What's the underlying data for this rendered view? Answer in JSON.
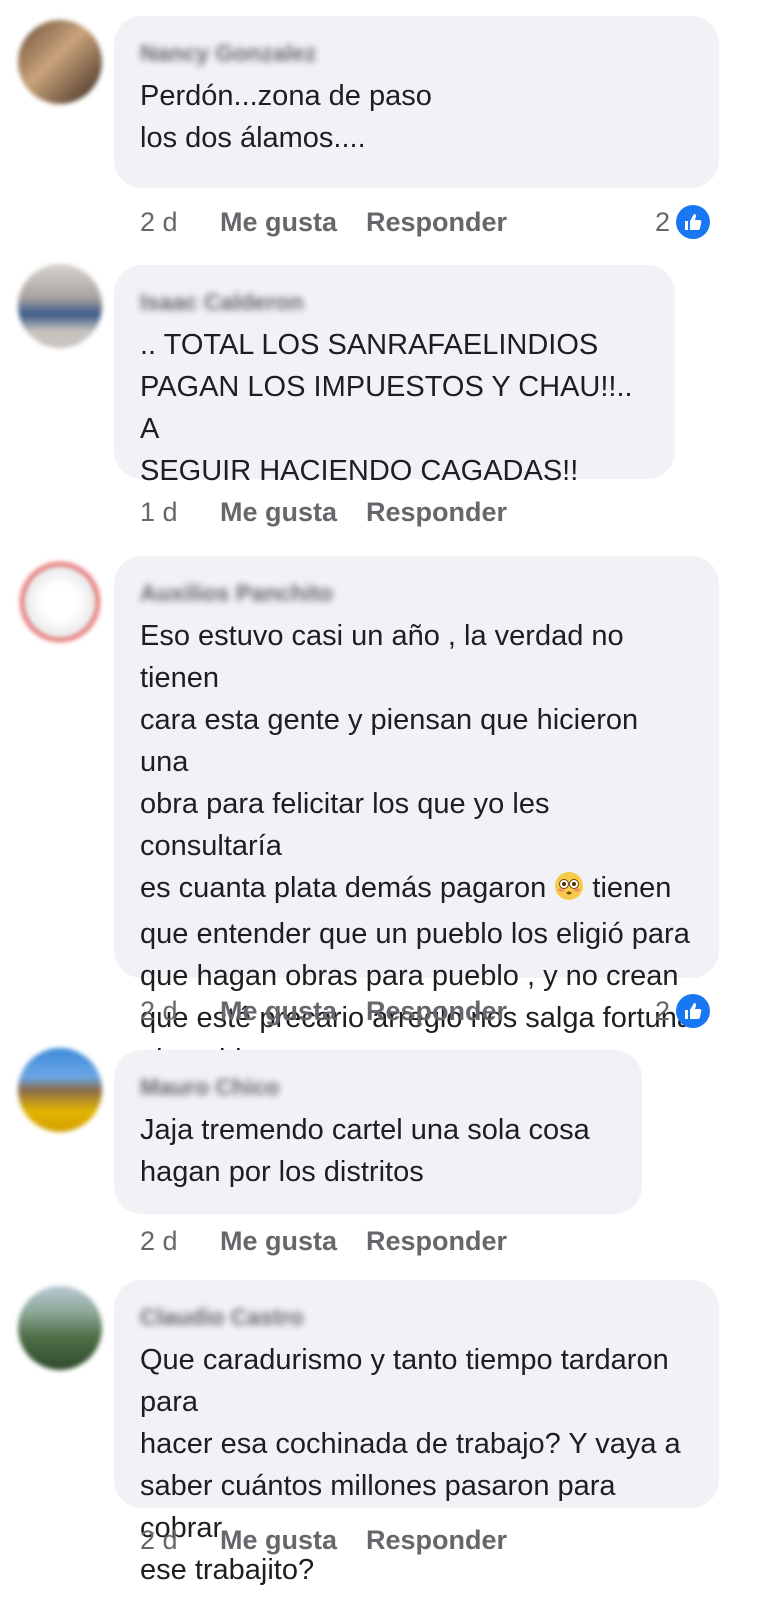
{
  "comments": [
    {
      "author": "Nancy Gonzalez",
      "text": "Perdón...zona de paso\nlos dos álamos....",
      "time": "2 d",
      "like_label": "Me gusta",
      "reply_label": "Responder",
      "reaction_count": "2"
    },
    {
      "author": "Isaac Calderon",
      "text": ".. TOTAL LOS SANRAFAELINDIOS\nPAGAN LOS IMPUESTOS Y CHAU!!.. A\nSEGUIR HACIENDO CAGADAS!!",
      "time": "1 d",
      "like_label": "Me gusta",
      "reply_label": "Responder"
    },
    {
      "author": "Auxilios Panchito",
      "text_before_emoji": "Eso estuvo casi un año , la verdad no tienen\ncara esta gente y piensan que hicieron una\nobra para felicitar los que yo les consultaría\nes cuanta plata demás pagaron ",
      "emoji": "flushed-face-emoji",
      "text_after_emoji": " tienen\nque entender que un pueblo los eligió para\nque hagan obras para pueblo , y no crean\nque esté precario arreglo nos salga fortuna\nal pueblo",
      "time": "2 d",
      "like_label": "Me gusta",
      "reply_label": "Responder",
      "reaction_count": "2"
    },
    {
      "author": "Mauro Chico",
      "text": "Jaja tremendo cartel una sola cosa\nhagan por los distritos",
      "time": "2 d",
      "like_label": "Me gusta",
      "reply_label": "Responder"
    },
    {
      "author": "Claudio Castro",
      "text": "Que caradurismo y tanto tiempo tardaron para\nhacer esa cochinada de trabajo? Y vaya a\nsaber cuántos millones pasaron para cobrar\nese trabajito?",
      "time": "2 d",
      "like_label": "Me gusta",
      "reply_label": "Responder"
    }
  ],
  "colors": {
    "bubble": "#f0f2f5",
    "meta_text": "#65676b",
    "like_badge": "#1877f2"
  },
  "icons": {
    "reaction": "thumbs-up-icon"
  }
}
